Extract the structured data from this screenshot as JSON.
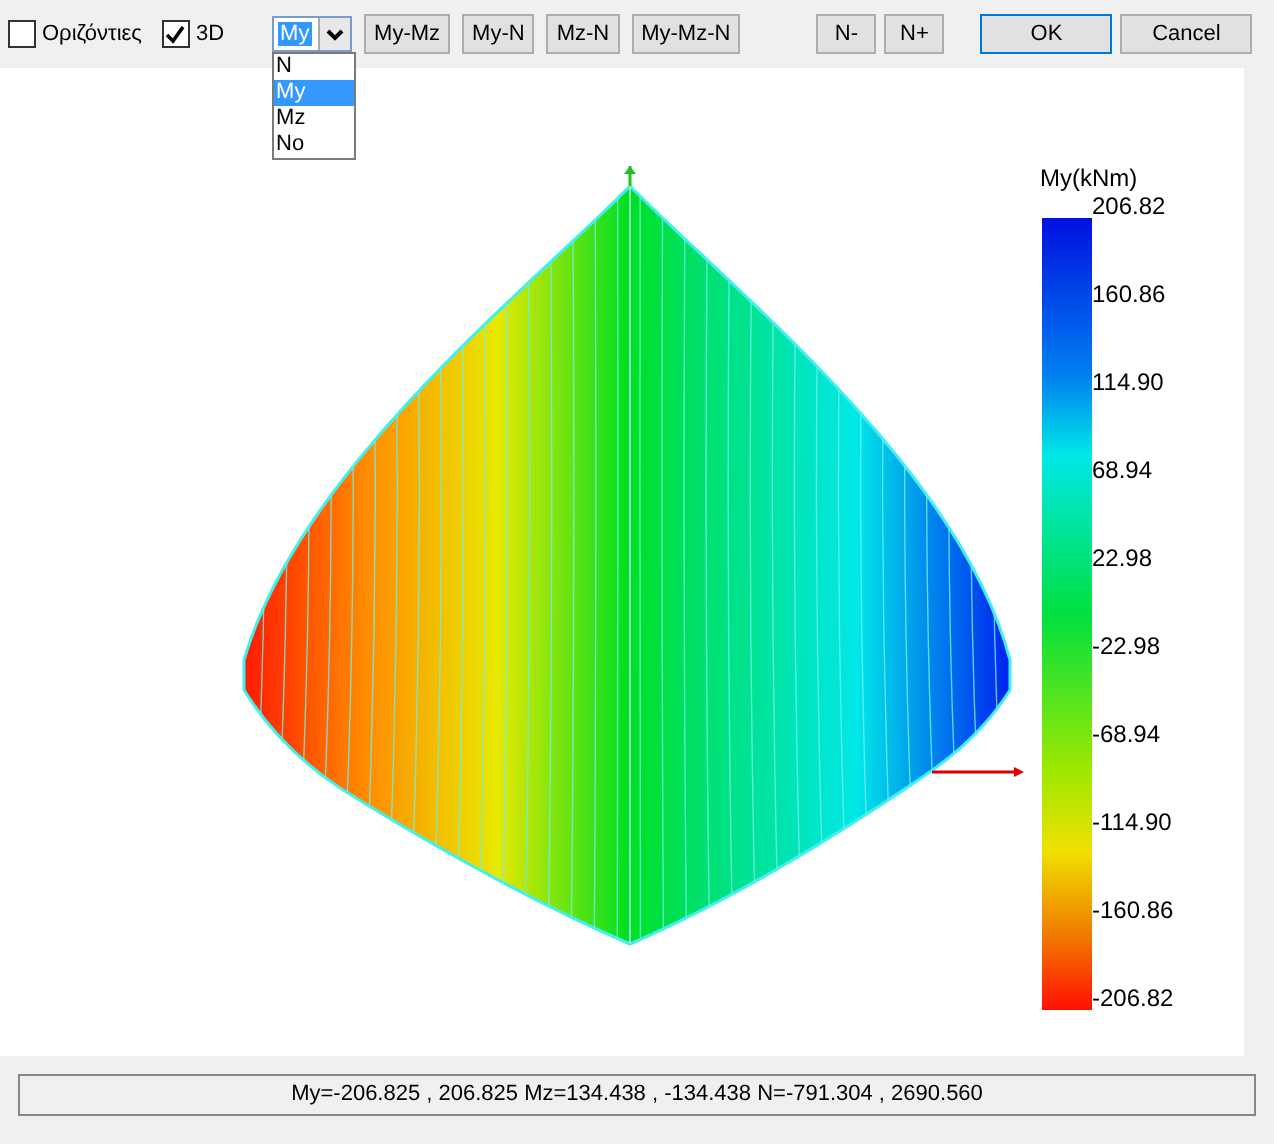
{
  "toolbar": {
    "checkboxes": [
      {
        "label": "Οριζόντιες",
        "checked": false
      },
      {
        "label": "3D",
        "checked": true
      }
    ],
    "combo": {
      "value": "My",
      "options": [
        {
          "label": "N",
          "selected": false
        },
        {
          "label": "My",
          "selected": true
        },
        {
          "label": "Mz",
          "selected": false
        },
        {
          "label": "No",
          "selected": false
        }
      ]
    },
    "view_buttons": [
      "My-Mz",
      "My-N",
      "Mz-N",
      "My-Mz-N"
    ],
    "axial_buttons": [
      "N-",
      "N+"
    ],
    "dialog_buttons": [
      {
        "label": "OK",
        "default": true
      },
      {
        "label": "Cancel",
        "default": false
      }
    ]
  },
  "legend": {
    "title": "My(kNm)",
    "ticks": [
      "206.82",
      "160.86",
      "114.90",
      "68.94",
      "22.98",
      "-22.98",
      "-68.94",
      "-114.90",
      "-160.86",
      "-206.82"
    ]
  },
  "status_bar": "My=-206.825 , 206.825 Mz=134.438 , -134.438 N=-791.304 , 2690.560"
}
